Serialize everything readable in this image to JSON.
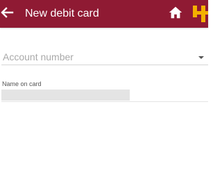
{
  "colors": {
    "app_bar": "#8f1a33",
    "app_bar_text": "#ffffff",
    "logo_accent": "#f4b000",
    "placeholder_text": "#a9a9a9",
    "divider": "#d5d5d5",
    "masked_field": "#e4e4e4"
  },
  "header": {
    "title": "New debit card",
    "back_icon": "arrow-left-icon",
    "home_icon": "home-icon",
    "logo_icon": "bank-logo-icon"
  },
  "form": {
    "account_number": {
      "placeholder": "Account number",
      "selected_value": "",
      "dropdown_icon": "caret-down-icon"
    },
    "name_on_card": {
      "label": "Name on card",
      "value": ""
    }
  }
}
